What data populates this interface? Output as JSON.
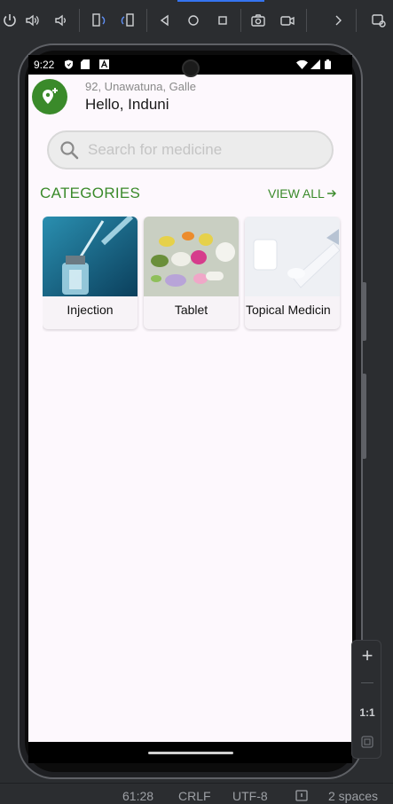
{
  "toolbar": {
    "icons": [
      "power-icon",
      "volume-up-icon",
      "volume-down-icon",
      "rotate-left-icon",
      "rotate-right-icon",
      "back-icon",
      "home-icon",
      "overview-icon",
      "screenshot-icon",
      "record-icon",
      "chevron-right-icon",
      "device-mirror-icon"
    ]
  },
  "status": {
    "time": "9:22"
  },
  "header": {
    "address": "92, Unawatuna, Galle",
    "greeting": "Hello, Induni"
  },
  "search": {
    "placeholder": "Search for medicine"
  },
  "categories": {
    "title": "CATEGORIES",
    "view_all": "VIEW ALL",
    "items": [
      {
        "label": "Injection"
      },
      {
        "label": "Tablet"
      },
      {
        "label": "Topical Medicin"
      }
    ]
  },
  "zoom": {
    "plus": "+",
    "minus": "—",
    "ratio": "1:1"
  },
  "ide_status": {
    "position": "61:28",
    "line_ending": "CRLF",
    "encoding": "UTF-8",
    "indent": "2 spaces"
  },
  "colors": {
    "accent": "#3a8a2a",
    "screen_bg": "#fdf8fd",
    "ide_bg": "#2b2d30"
  }
}
